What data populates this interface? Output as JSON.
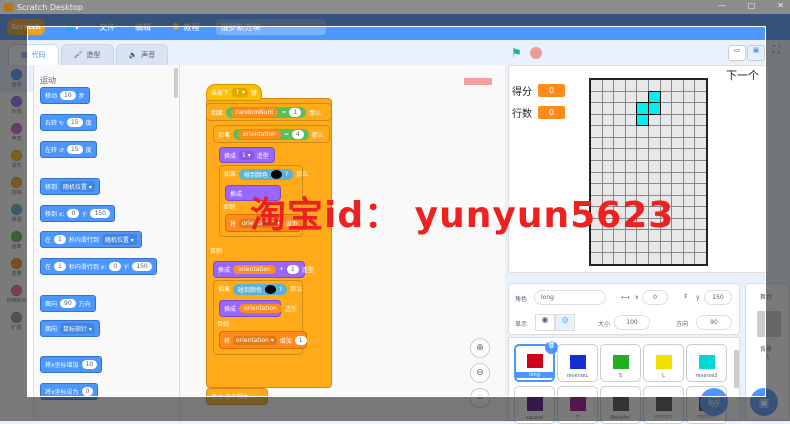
{
  "window": {
    "title": "Scratch Desktop",
    "min": "—",
    "max": "□",
    "close": "✕"
  },
  "menubar": {
    "logo": "Scratch",
    "file": "文件",
    "edit": "编辑",
    "tutorials": "教程",
    "project_name": "俄罗斯方块"
  },
  "tabs": [
    {
      "label": "代码"
    },
    {
      "label": "造型"
    },
    {
      "label": "声音"
    }
  ],
  "categories": [
    {
      "label": "运动",
      "color": "#4c97ff"
    },
    {
      "label": "外观",
      "color": "#9966ff"
    },
    {
      "label": "声音",
      "color": "#cf63cf"
    },
    {
      "label": "事件",
      "color": "#ffbf00"
    },
    {
      "label": "控制",
      "color": "#ffab19"
    },
    {
      "label": "侦测",
      "color": "#5cb1d6"
    },
    {
      "label": "运算",
      "color": "#59c059"
    },
    {
      "label": "变量",
      "color": "#ff8c1a"
    },
    {
      "label": "自制积木",
      "color": "#ff6680"
    },
    {
      "label": "扩展",
      "color": "#8e9bb0"
    }
  ],
  "palette": {
    "section": "运动",
    "blocks": [
      {
        "t1": "移动",
        "v1": "10",
        "t2": "步"
      },
      {
        "t1": "右转 ↻",
        "v1": "15",
        "t2": "度"
      },
      {
        "t1": "左转 ↺",
        "v1": "15",
        "t2": "度"
      },
      {
        "t1": "移到",
        "dd": "随机位置 ▾"
      },
      {
        "t1": "移到 x:",
        "v1": "0",
        "t2": "y:",
        "v2": "150"
      },
      {
        "t1": "在",
        "v1": "1",
        "t2": "秒内滑行到",
        "dd": "随机位置 ▾"
      },
      {
        "t1": "在",
        "v1": "1",
        "t2": "秒内滑行到 x:",
        "v2": "0",
        "t3": "y:",
        "v3": "150"
      },
      {
        "t1": "面向",
        "v1": "90",
        "t2": "方向"
      },
      {
        "t1": "面向",
        "dd": "鼠标指针 ▾"
      },
      {
        "t1": "将x坐标增加",
        "v1": "10"
      },
      {
        "t1": "将x坐标设为",
        "v1": "0"
      }
    ]
  },
  "script": {
    "hat": "当按下",
    "hat_key": "↑ ▾",
    "hat_end": "键",
    "if": "如果",
    "then": "那么",
    "else": "否则",
    "v_random": "randomNum",
    "v_orient": "orientation",
    "eq": "=",
    "plus": "+",
    "one": "1",
    "four": "4",
    "switch": "换成",
    "costume": "造型",
    "costume_val": "1 ▾",
    "touch": "碰到颜色",
    "q": "?",
    "set": "将",
    "set_to": "设为",
    "change_by": "增加",
    "var_dd": "orientation ▾",
    "bottom": "停止 这个脚本 ▾"
  },
  "stage": {
    "score_label": "得分",
    "score": "0",
    "lines_label": "行数",
    "lines": "0",
    "next_label": "下一个",
    "grid_cols": 10,
    "grid_rows": 16,
    "active_cells": [
      [
        5,
        1
      ],
      [
        4,
        2
      ],
      [
        5,
        2
      ],
      [
        4,
        3
      ]
    ],
    "piece_color": "#00f0f0"
  },
  "sprite_info": {
    "sprite_label": "角色",
    "sprite_name": "long",
    "x_label": "x",
    "x": "0",
    "y_label": "y",
    "y": "150",
    "show_label": "显示",
    "size_label": "大小",
    "size": "100",
    "dir_label": "方向",
    "direction": "90"
  },
  "sprites": [
    {
      "name": "long",
      "color": "#d0021b"
    },
    {
      "name": "reverseL",
      "color": "#1030d0"
    },
    {
      "name": "S",
      "color": "#20b020"
    },
    {
      "name": "L",
      "color": "#f0e000"
    },
    {
      "name": "reverse3",
      "color": "#00d8d8"
    },
    {
      "name": "square",
      "color": "#4a0080"
    },
    {
      "name": "T",
      "color": "#900080"
    },
    {
      "name": "Beliefer",
      "color": "#444"
    },
    {
      "name": "???????",
      "color": "#444"
    },
    {
      "name": "???????",
      "color": "#444"
    }
  ],
  "backdrop": {
    "label": "舞台",
    "count_label": "背景",
    "count": "1"
  },
  "watermark": "淘宝id： yunyun5623"
}
